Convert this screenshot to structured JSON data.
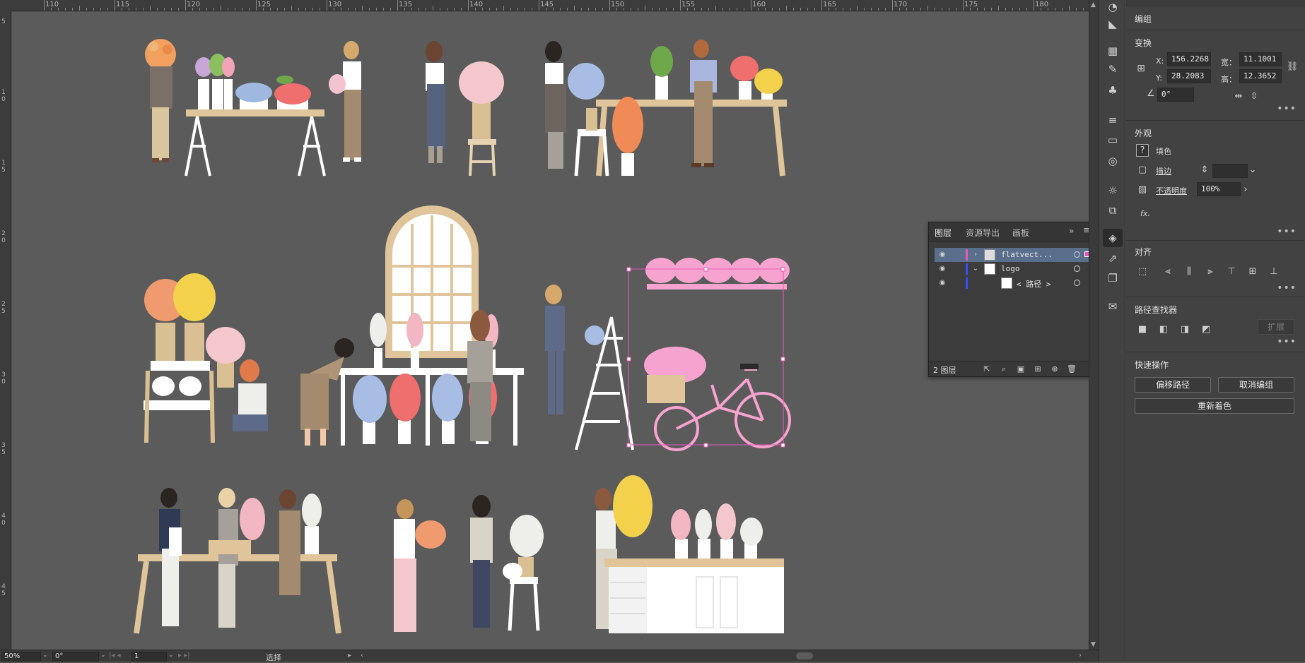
{
  "ruler": {
    "top_labels": [
      "110",
      "115",
      "120",
      "125",
      "130",
      "135",
      "140",
      "145",
      "150",
      "155",
      "160",
      "165",
      "170",
      "175",
      "180"
    ],
    "left_labels": [
      "5",
      "1 0",
      "1 5",
      "2 0",
      "2 5",
      "3 0",
      "3 5",
      "4 0",
      "4 5"
    ]
  },
  "properties": {
    "group_label": "编组",
    "transform": {
      "title": "变换",
      "x_label": "X:",
      "x_value": "156.2268",
      "y_label": "Y:",
      "y_value": "28.2083",
      "w_label": "宽：",
      "w_value": "11.1001",
      "h_label": "高：",
      "h_value": "12.3652",
      "angle_value": "0°"
    },
    "appearance": {
      "title": "外观",
      "fill_label": "填色",
      "stroke_label": "描边",
      "opacity_label": "不透明度",
      "opacity_value": "100%",
      "fx_label": "fx."
    },
    "align": {
      "title": "对齐"
    },
    "pathfinder": {
      "title": "路径查找器",
      "expand_label": "扩展"
    },
    "quick_actions": {
      "title": "快速操作",
      "offset_path": "偏移路径",
      "ungroup": "取消编组",
      "recolor": "重新着色"
    }
  },
  "layers_panel": {
    "tabs": [
      "图层",
      "资源导出",
      "画板"
    ],
    "rows": [
      {
        "name": "flatvect...",
        "color": "#e85ab9",
        "selected": true
      },
      {
        "name": "logo",
        "color": "#3a50ff",
        "selected": false
      },
      {
        "name": "< 路径 >",
        "color": "#3a50ff",
        "selected": false
      }
    ],
    "footer_count": "2 图层"
  },
  "status_bar": {
    "zoom": "50%",
    "rotation": "0°",
    "artboard": "1",
    "mode": "选择"
  },
  "colors": {
    "selection": "#e85ab9",
    "layer_blue": "#3a50ff",
    "bike_pink": "#f7a3cf"
  }
}
